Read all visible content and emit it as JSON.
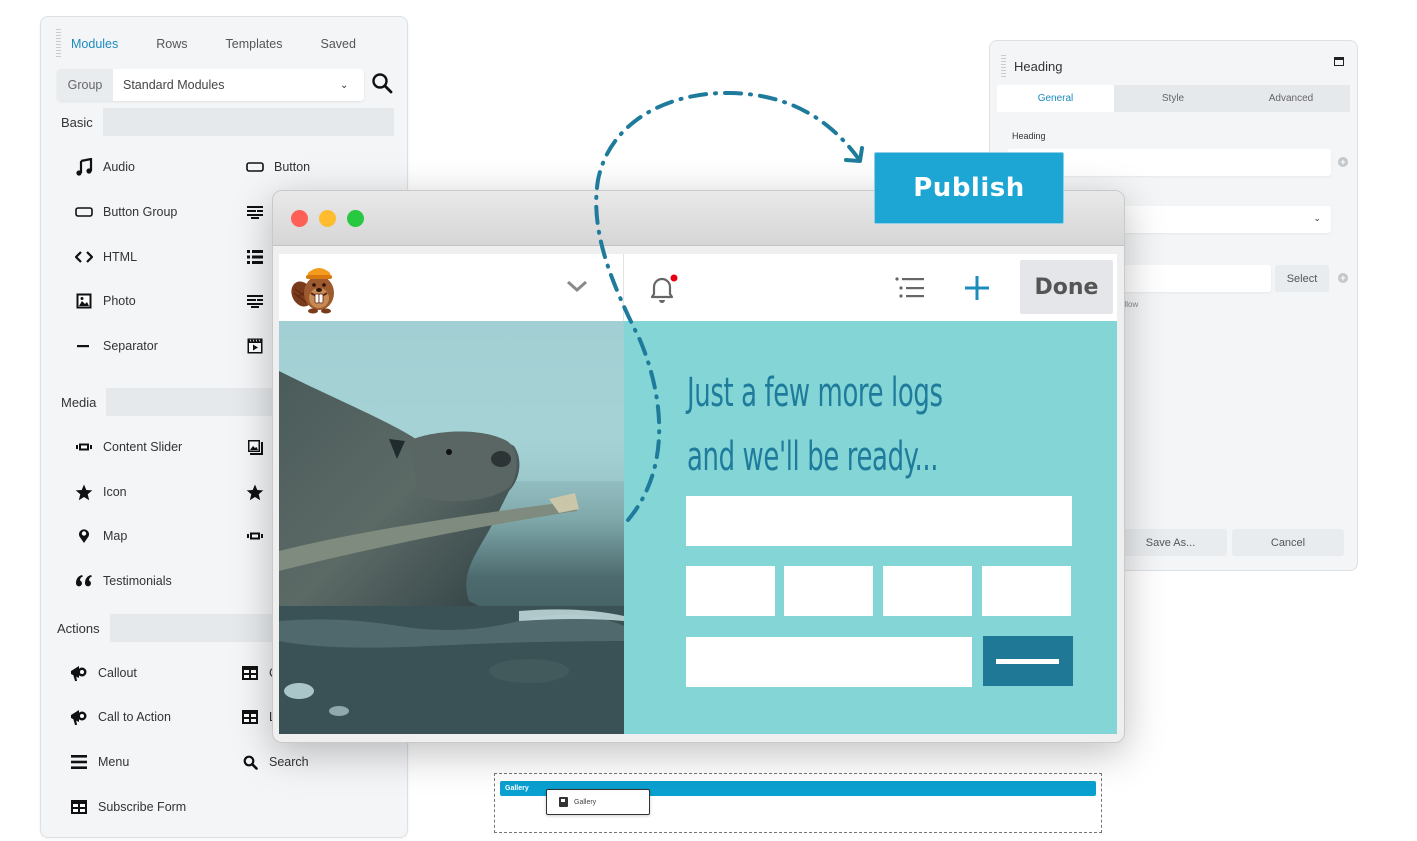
{
  "modules_panel": {
    "tabs": [
      {
        "label": "Modules",
        "active": true
      },
      {
        "label": "Rows",
        "active": false
      },
      {
        "label": "Templates",
        "active": false
      },
      {
        "label": "Saved",
        "active": false
      }
    ],
    "group_label": "Group",
    "group_value": "Standard Modules",
    "search_icon": "search-icon",
    "sections": {
      "basic": {
        "title": "Basic",
        "items": [
          {
            "label": "Audio",
            "icon": "music-note-icon"
          },
          {
            "label": "Button",
            "icon": "button-icon"
          },
          {
            "label": "Button Group",
            "icon": "button-icon"
          },
          {
            "label": "",
            "icon": "text-editor-icon"
          },
          {
            "label": "HTML",
            "icon": "code-icon"
          },
          {
            "label": "",
            "icon": "list-icon"
          },
          {
            "label": "Photo",
            "icon": "photo-icon"
          },
          {
            "label": "",
            "icon": "text-editor-icon"
          },
          {
            "label": "Separator",
            "icon": "minus-icon"
          },
          {
            "label": "",
            "icon": "video-icon"
          }
        ]
      },
      "media": {
        "title": "Media",
        "items": [
          {
            "label": "Content Slider",
            "icon": "slider-icon"
          },
          {
            "label": "",
            "icon": "gallery-icon"
          },
          {
            "label": "Icon",
            "icon": "star-icon"
          },
          {
            "label": "",
            "icon": "star-icon"
          },
          {
            "label": "Map",
            "icon": "map-pin-icon"
          },
          {
            "label": "",
            "icon": "slider-icon"
          },
          {
            "label": "Testimonials",
            "icon": "quote-icon"
          }
        ]
      },
      "actions": {
        "title": "Actions",
        "items": [
          {
            "label": "Callout",
            "icon": "megaphone-icon"
          },
          {
            "label": "C",
            "icon": "table-icon"
          },
          {
            "label": "Call to Action",
            "icon": "megaphone-icon"
          },
          {
            "label": "L",
            "icon": "table-icon"
          },
          {
            "label": "Menu",
            "icon": "menu-icon"
          },
          {
            "label": "Search",
            "icon": "search-icon"
          },
          {
            "label": "Subscribe Form",
            "icon": "table-icon"
          }
        ]
      }
    }
  },
  "heading_panel": {
    "title": "Heading",
    "tabs": [
      {
        "label": "General",
        "active": true
      },
      {
        "label": "Style",
        "active": false
      },
      {
        "label": "Advanced",
        "active": false
      }
    ],
    "field_label": "Heading",
    "heading_value": "",
    "select_button": "Select",
    "follow_text": "ollow",
    "save_as_button": "Save As...",
    "cancel_button": "Cancel"
  },
  "publish_button": "Publish",
  "browser": {
    "done_button": "Done",
    "notification_dot_color": "#e60012",
    "headline_line1": "Just a few more logs",
    "headline_line2": "and we'll be ready...",
    "accent_color": "#1e7b9b",
    "teal_bg": "#84d5d5"
  },
  "gallery": {
    "bar_label": "Gallery",
    "chip_label": "Gallery"
  }
}
